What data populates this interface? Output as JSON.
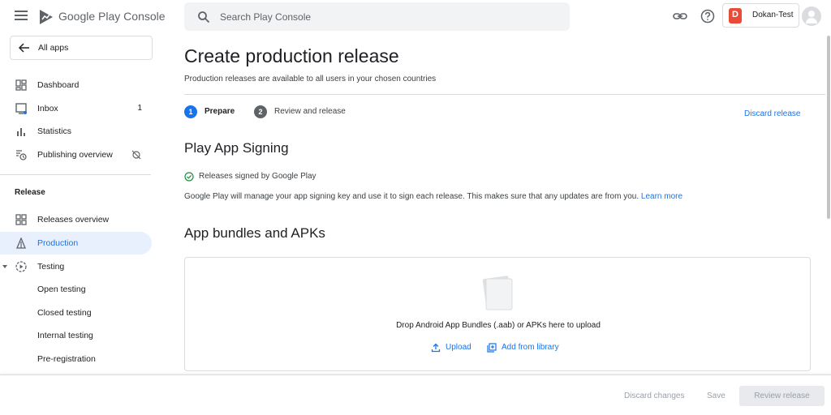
{
  "topbar": {
    "brand_google_play": "Google Play",
    "brand_console": "Console",
    "search_placeholder": "Search Play Console",
    "account_name": "Dokan-Test",
    "icons": [
      "menu-icon",
      "link-icon",
      "help-icon",
      "avatar-icon"
    ]
  },
  "sidebar": {
    "all_apps": "All apps",
    "items": [
      {
        "label": "Dashboard",
        "icon": "dashboard-icon"
      },
      {
        "label": "Inbox",
        "icon": "inbox-icon",
        "count": "1"
      },
      {
        "label": "Statistics",
        "icon": "statistics-icon"
      },
      {
        "label": "Publishing overview",
        "icon": "publishing-icon"
      }
    ],
    "release_heading": "Release",
    "release_items": [
      {
        "label": "Releases overview",
        "icon": "releases-icon"
      },
      {
        "label": "Production",
        "icon": "production-icon",
        "active": true
      },
      {
        "label": "Testing",
        "icon": "testing-icon"
      },
      {
        "label": "Open testing"
      },
      {
        "label": "Closed testing"
      },
      {
        "label": "Internal testing"
      },
      {
        "label": "Pre-registration"
      }
    ]
  },
  "main": {
    "title": "Create production release",
    "subtitle": "Production releases are available to all users in your chosen countries",
    "steps": [
      {
        "num": "1",
        "label": "Prepare"
      },
      {
        "num": "2",
        "label": "Review and release"
      }
    ],
    "discard_release": "Discard release",
    "signing": {
      "heading": "Play App Signing",
      "status": "Releases signed by Google Play",
      "description": "Google Play will manage your app signing key and use it to sign each release. This makes sure that any updates are from you.",
      "learn_more": "Learn more"
    },
    "bundles": {
      "heading": "App bundles and APKs",
      "drop_text": "Drop Android App Bundles (.aab) or APKs here to upload",
      "upload": "Upload",
      "add_from_library": "Add from library"
    }
  },
  "footer": {
    "discard_changes": "Discard changes",
    "save": "Save",
    "review_release": "Review release"
  },
  "colors": {
    "accent": "#1a73e8",
    "active_bg": "#e8f0fe",
    "success": "#1e8e3e",
    "step_inactive": "#5f6368"
  }
}
